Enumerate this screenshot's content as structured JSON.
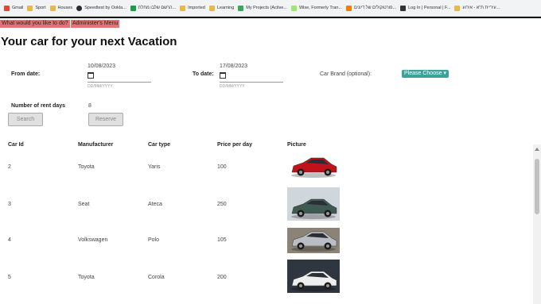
{
  "bookmarks": [
    "Gmail",
    "Sport",
    "Houses",
    "Speedtest by Ookla...",
    "הרשם שלבו מחלת...",
    "Imported",
    "Learning",
    "My Projects (Active...",
    "Wise, Formerly Tran...",
    "פורטוקולים של דיונים...",
    "Log In | Personal | F...",
    "עיריית ת\"א - אירוע..."
  ],
  "menu": {
    "what": "What would you like to do?",
    "admin": "Administer's Menu"
  },
  "page": {
    "title": "Your car for your next Vacation"
  },
  "form": {
    "from_label": "From date:",
    "from_value": "10/08/2023",
    "from_placeholder": "DD/MM/YYYY",
    "to_label": "To date:",
    "to_value": "17/08/2023",
    "to_placeholder": "DD/MM/YYYY",
    "brand_label": "Car Brand (optional):",
    "brand_value": "Please Choose",
    "days_label": "Number of rent days",
    "days_value": "8",
    "search_label": "Search",
    "reserve_label": "Reserve"
  },
  "table": {
    "headers": [
      "Car Id",
      "Manufacturer",
      "Car type",
      "Price per day",
      "Picture"
    ],
    "rows": [
      {
        "id": "2",
        "manufacturer": "Toyota",
        "type": "Yaris",
        "price": "100",
        "color": "#c0121a",
        "bg": "#ffffff"
      },
      {
        "id": "3",
        "manufacturer": "Seat",
        "type": "Ateca",
        "price": "250",
        "color": "#3f5a52",
        "bg": "#cfd6dc"
      },
      {
        "id": "4",
        "manufacturer": "Volkswagen",
        "type": "Polo",
        "price": "105",
        "color": "#b9bec4",
        "bg": "#8c8377"
      },
      {
        "id": "5",
        "manufacturer": "Toyota",
        "type": "Corola",
        "price": "200",
        "color": "#eeeeee",
        "bg": "#2f3640"
      }
    ]
  }
}
